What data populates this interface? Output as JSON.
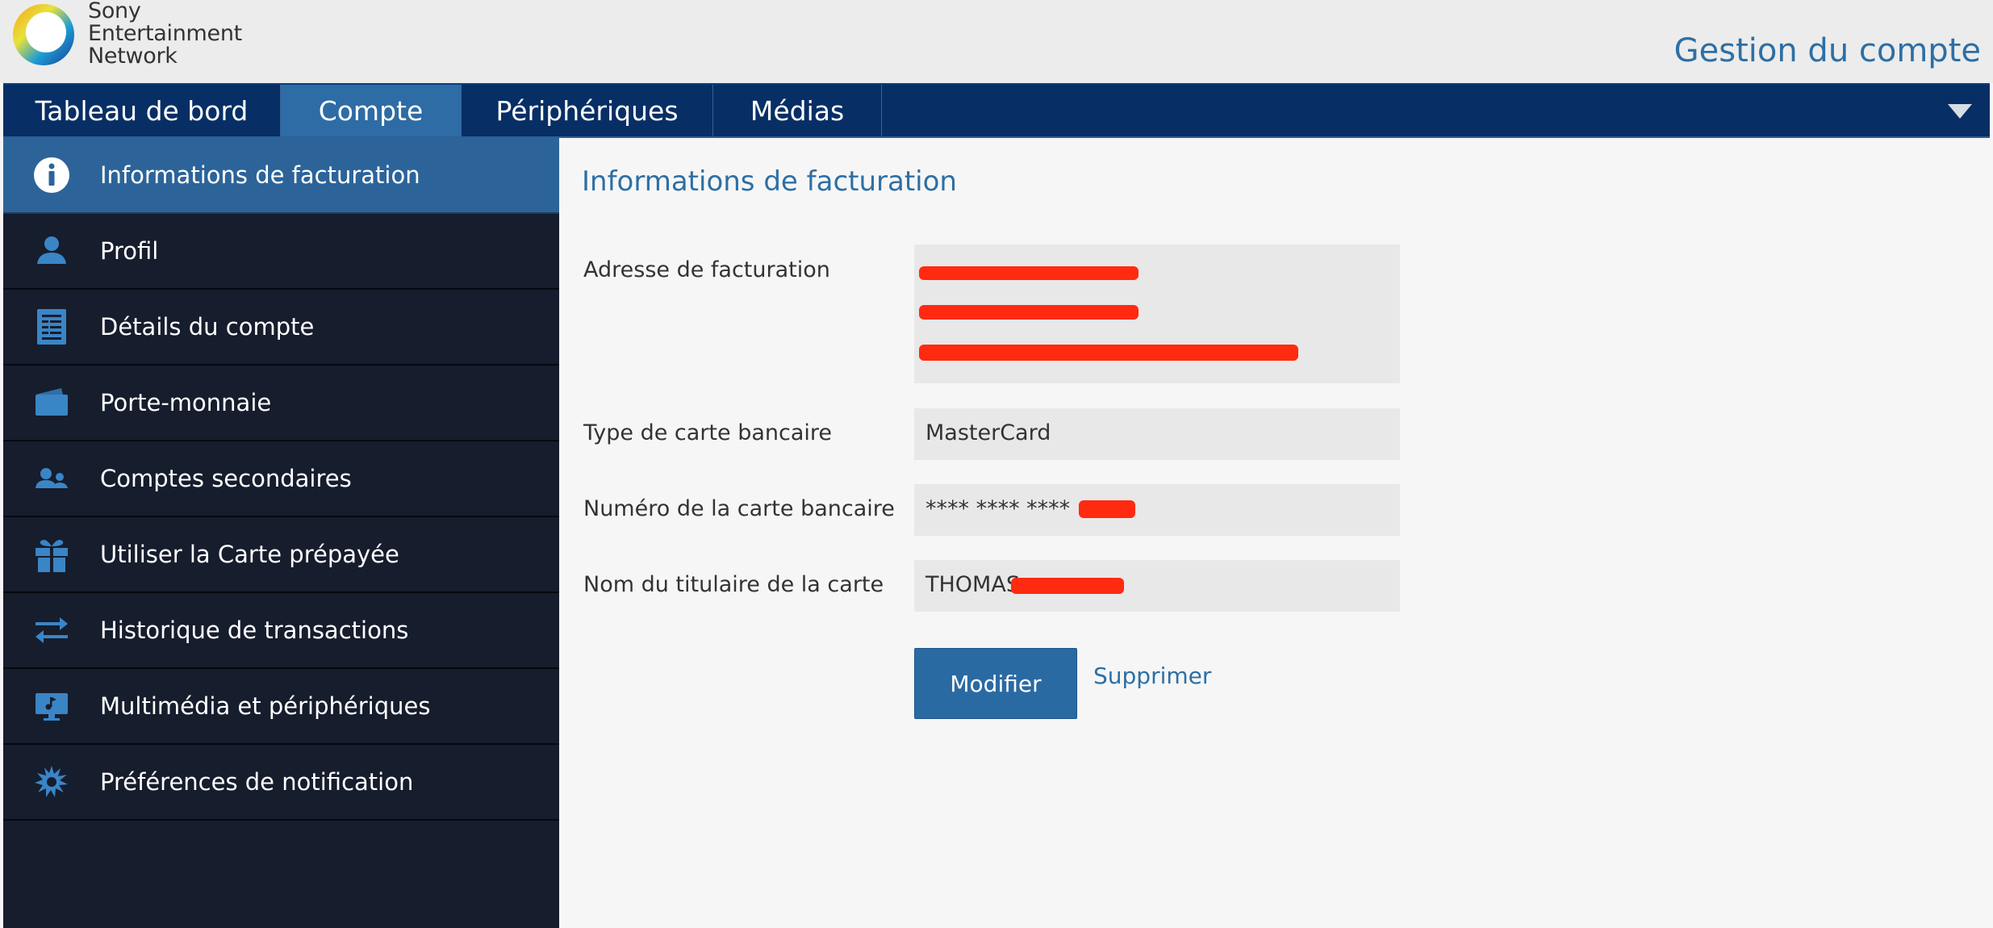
{
  "header": {
    "brand_line1": "Sony",
    "brand_line2": "Entertainment",
    "brand_line3": "Network",
    "account_title": "Gestion du compte"
  },
  "topnav": {
    "tabs": [
      {
        "label": "Tableau de bord",
        "active": false
      },
      {
        "label": "Compte",
        "active": true
      },
      {
        "label": "Périphériques",
        "active": false
      },
      {
        "label": "Médias",
        "active": false
      }
    ]
  },
  "sidebar": {
    "items": [
      {
        "label": "Informations de facturation",
        "icon": "info-icon",
        "active": true
      },
      {
        "label": "Profil",
        "icon": "user-icon",
        "active": false
      },
      {
        "label": "Détails du compte",
        "icon": "document-icon",
        "active": false
      },
      {
        "label": "Porte-monnaie",
        "icon": "wallet-icon",
        "active": false
      },
      {
        "label": "Comptes secondaires",
        "icon": "users-icon",
        "active": false
      },
      {
        "label": "Utiliser la Carte prépayée",
        "icon": "gift-icon",
        "active": false
      },
      {
        "label": "Historique de transactions",
        "icon": "transfer-arrows-icon",
        "active": false
      },
      {
        "label": "Multimédia et périphériques",
        "icon": "media-device-icon",
        "active": false
      },
      {
        "label": "Préférences de notification",
        "icon": "notification-burst-icon",
        "active": false
      }
    ]
  },
  "main": {
    "title": "Informations de facturation",
    "fields": {
      "billing_address_label": "Adresse de facturation",
      "card_type_label": "Type de carte bancaire",
      "card_type_value": "MasterCard",
      "card_number_label": "Numéro de la carte bancaire",
      "card_number_value": "**** **** ****",
      "card_holder_label": "Nom du titulaire de la carte",
      "card_holder_value": "THOMAS"
    },
    "modify_button": "Modifier",
    "delete_link": "Supprimer"
  },
  "colors": {
    "nav_bg": "#072f65",
    "active_blue": "#2d6ca5",
    "sidebar_bg": "#161d2d",
    "accent_text": "#2d6fa5",
    "redaction": "#ff2a10"
  }
}
